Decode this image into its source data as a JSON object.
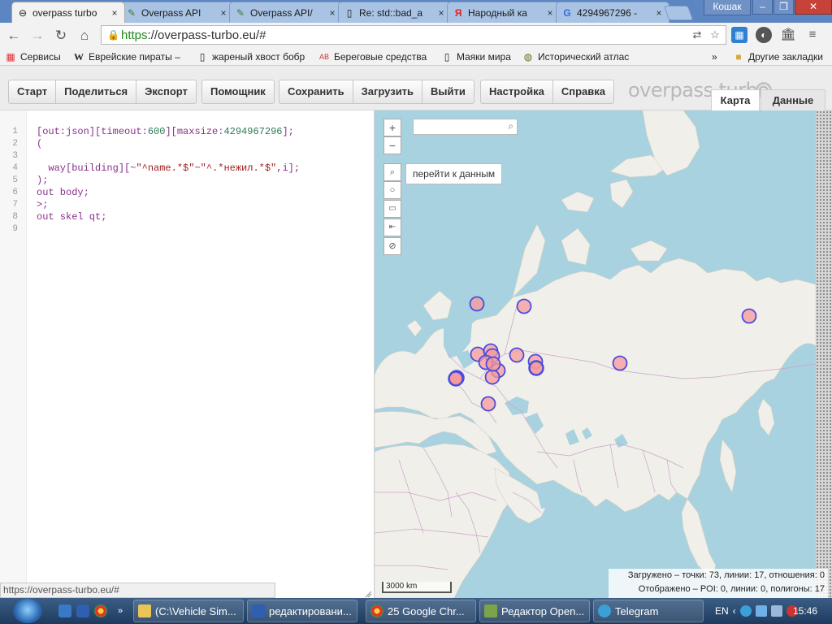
{
  "browser": {
    "tabs": [
      {
        "title": "overpass turbo",
        "active": true
      },
      {
        "title": "Overpass API",
        "active": false
      },
      {
        "title": "Overpass API/",
        "active": false
      },
      {
        "title": "Re: std::bad_a",
        "active": false
      },
      {
        "title": "Народный ка",
        "active": false
      },
      {
        "title": "4294967296 -",
        "active": false
      }
    ],
    "user_badge": "Кошак",
    "window_buttons": {
      "minimize": "–",
      "maximize": "❐",
      "close": "✕"
    },
    "url_scheme": "https",
    "url_rest": "://overpass-turbo.eu/#",
    "bookmarks": [
      {
        "label": "Сервисы",
        "icon": "apps-grid-icon"
      },
      {
        "label": "Еврейские пираты –",
        "icon": "wikipedia-icon"
      },
      {
        "label": "жареный хвост бобр",
        "icon": "page-icon"
      },
      {
        "label": "Береговые средства",
        "icon": "abc-icon"
      },
      {
        "label": "Маяки мира",
        "icon": "page-icon"
      },
      {
        "label": "Исторический атлас",
        "icon": "globe-icon"
      }
    ],
    "bookmarks_overflow": "»",
    "other_bookmarks": "Другие закладки",
    "status_url": "https://overpass-turbo.eu/#"
  },
  "app": {
    "toolbar": {
      "groups": [
        [
          "Старт",
          "Поделиться",
          "Экспорт"
        ],
        [
          "Помощник"
        ],
        [
          "Сохранить",
          "Загрузить",
          "Выйти"
        ],
        [
          "Настройка",
          "Справка"
        ]
      ]
    },
    "logo": "overpass turbo",
    "view_tabs": {
      "map": "Карта",
      "data": "Данные",
      "active": "map"
    }
  },
  "editor": {
    "line_numbers": [
      "1",
      "2",
      "3",
      "4",
      "5",
      "6",
      "7",
      "8",
      "9"
    ],
    "lines": [
      [
        {
          "t": "[out:json][timeout:",
          "c": "kw"
        },
        {
          "t": "600",
          "c": "num"
        },
        {
          "t": "][maxsize:",
          "c": "kw"
        },
        {
          "t": "4294967296",
          "c": "num"
        },
        {
          "t": "];",
          "c": "kw"
        }
      ],
      [
        {
          "t": "(",
          "c": "kw"
        }
      ],
      [],
      [
        {
          "t": "  way[building][~",
          "c": "kw"
        },
        {
          "t": "\"^name.*$\"",
          "c": "str"
        },
        {
          "t": "~",
          "c": "kw"
        },
        {
          "t": "\"^.*нежил.*$\"",
          "c": "str"
        },
        {
          "t": ",i];",
          "c": "kw"
        }
      ],
      [
        {
          "t": ");",
          "c": "kw"
        }
      ],
      [
        {
          "t": "out body;",
          "c": "kw"
        }
      ],
      [
        {
          "t": ">;",
          "c": "kw"
        }
      ],
      [
        {
          "t": "out skel qt;",
          "c": "kw"
        }
      ],
      []
    ]
  },
  "map": {
    "zoom_in": "+",
    "zoom_out": "−",
    "tooltip": "перейти к данным",
    "scale_label": "3000 km",
    "stats_line1": "Загружено – точки: 73, линии: 17, отношения: 0",
    "stats_line2": "Отображено – POI: 0, линии: 0, полигоны: 17",
    "colors": {
      "sea": "#a8d2df",
      "land": "#f1efe9",
      "marker_fill": "#f59a9a",
      "marker_stroke": "#4b4be0",
      "border": "#c9a3c9"
    }
  },
  "taskbar": {
    "tasks": [
      {
        "label": "(C:\\Vehicle Sim...",
        "icon": "explorer-icon"
      },
      {
        "label": "редактировани...",
        "icon": "word-icon"
      },
      {
        "label": "25 Google Chr...",
        "icon": "chrome-icon"
      },
      {
        "label": "Редактор Open...",
        "icon": "editor-icon"
      },
      {
        "label": "Telegram",
        "icon": "telegram-icon"
      }
    ],
    "lang": "EN",
    "clock": "15:46"
  }
}
